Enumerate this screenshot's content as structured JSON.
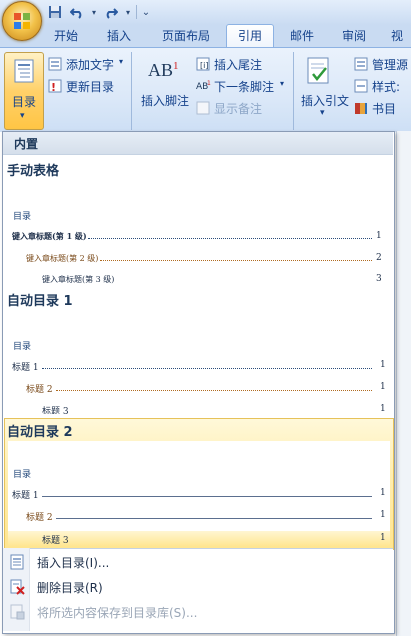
{
  "quick_access": {
    "save_icon": "save-icon",
    "undo_icon": "undo-icon",
    "redo_icon": "redo-icon",
    "customize_icon": "customize-qat-icon"
  },
  "tabs": [
    "开始",
    "插入",
    "页面布局",
    "引用",
    "邮件",
    "审阅",
    "视"
  ],
  "active_tab": "引用",
  "ribbon": {
    "toc_label": "目录",
    "add_text": "添加文字",
    "update_toc": "更新目录",
    "insert_footnote": "插入脚注",
    "insert_endnote": "插入尾注",
    "next_footnote": "下一条脚注",
    "show_notes": "显示备注",
    "insert_citation": "插入引文",
    "manage_sources": "管理源",
    "style": "样式:",
    "bibliography": "书目",
    "footnote_icon_text": "AB",
    "footnote_icon_sup": "1"
  },
  "dropdown": {
    "section_header": "内置",
    "items": [
      {
        "title": "手动表格",
        "preview_heading": "目录",
        "entries": [
          {
            "text": "键入章标题(第 1 级)",
            "page": "1"
          },
          {
            "text": "键入章标题(第 2 级)",
            "page": "2"
          },
          {
            "text": "键入章标题(第 3 级)",
            "page": "3"
          }
        ]
      },
      {
        "title": "自动目录 1",
        "preview_heading": "目录",
        "entries": [
          {
            "text": "标题 1",
            "page": "1"
          },
          {
            "text": "标题 2",
            "page": "1"
          },
          {
            "text": "标题 3",
            "page": "1"
          }
        ]
      },
      {
        "title": "自动目录 2",
        "preview_heading": "目录",
        "entries": [
          {
            "text": "标题 1",
            "page": "1"
          },
          {
            "text": "标题 2",
            "page": "1"
          },
          {
            "text": "标题 3",
            "page": "1"
          }
        ]
      }
    ],
    "menu": [
      {
        "label": "插入目录(I)...",
        "icon": "insert-toc-icon",
        "enabled": true
      },
      {
        "label": "删除目录(R)",
        "icon": "remove-toc-icon",
        "enabled": true
      },
      {
        "label": "将所选内容保存到目录库(S)...",
        "icon": "save-selection-icon",
        "enabled": false
      }
    ]
  },
  "colors": {
    "accent": "#15428b",
    "hover": "#ffe590",
    "ribbon": "#dbe8f8"
  }
}
